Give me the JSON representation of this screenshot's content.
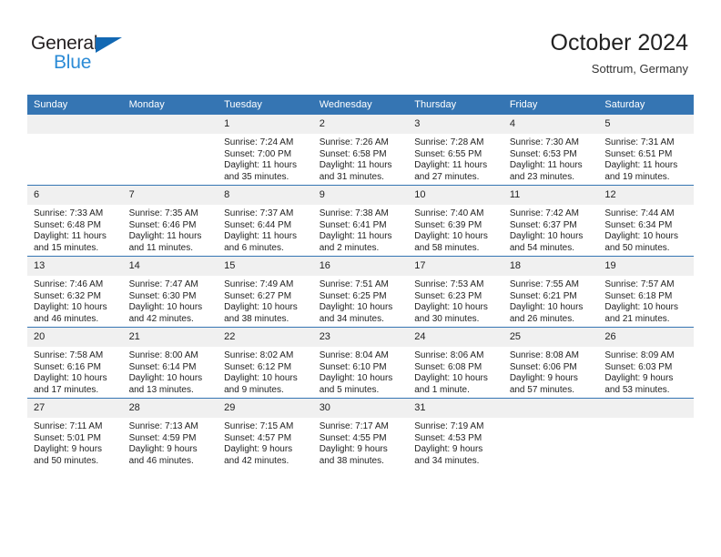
{
  "brand": {
    "name_part1": "General",
    "name_part2": "Blue",
    "accent_color": "#2b8bd6",
    "triangle_color": "#1268b3"
  },
  "header": {
    "title": "October 2024",
    "subtitle": "Sottrum, Germany"
  },
  "theme": {
    "header_bar_color": "#3575b3",
    "daynum_band_color": "#f0f0f0",
    "text_color": "#222222"
  },
  "weekdays": [
    "Sunday",
    "Monday",
    "Tuesday",
    "Wednesday",
    "Thursday",
    "Friday",
    "Saturday"
  ],
  "labels": {
    "sunrise": "Sunrise:",
    "sunset": "Sunset:",
    "daylight": "Daylight:"
  },
  "weeks": [
    [
      {
        "day": "",
        "sunrise": "",
        "sunset": "",
        "daylight_line1": "",
        "daylight_line2": ""
      },
      {
        "day": "",
        "sunrise": "",
        "sunset": "",
        "daylight_line1": "",
        "daylight_line2": ""
      },
      {
        "day": "1",
        "sunrise": "Sunrise: 7:24 AM",
        "sunset": "Sunset: 7:00 PM",
        "daylight_line1": "Daylight: 11 hours",
        "daylight_line2": "and 35 minutes."
      },
      {
        "day": "2",
        "sunrise": "Sunrise: 7:26 AM",
        "sunset": "Sunset: 6:58 PM",
        "daylight_line1": "Daylight: 11 hours",
        "daylight_line2": "and 31 minutes."
      },
      {
        "day": "3",
        "sunrise": "Sunrise: 7:28 AM",
        "sunset": "Sunset: 6:55 PM",
        "daylight_line1": "Daylight: 11 hours",
        "daylight_line2": "and 27 minutes."
      },
      {
        "day": "4",
        "sunrise": "Sunrise: 7:30 AM",
        "sunset": "Sunset: 6:53 PM",
        "daylight_line1": "Daylight: 11 hours",
        "daylight_line2": "and 23 minutes."
      },
      {
        "day": "5",
        "sunrise": "Sunrise: 7:31 AM",
        "sunset": "Sunset: 6:51 PM",
        "daylight_line1": "Daylight: 11 hours",
        "daylight_line2": "and 19 minutes."
      }
    ],
    [
      {
        "day": "6",
        "sunrise": "Sunrise: 7:33 AM",
        "sunset": "Sunset: 6:48 PM",
        "daylight_line1": "Daylight: 11 hours",
        "daylight_line2": "and 15 minutes."
      },
      {
        "day": "7",
        "sunrise": "Sunrise: 7:35 AM",
        "sunset": "Sunset: 6:46 PM",
        "daylight_line1": "Daylight: 11 hours",
        "daylight_line2": "and 11 minutes."
      },
      {
        "day": "8",
        "sunrise": "Sunrise: 7:37 AM",
        "sunset": "Sunset: 6:44 PM",
        "daylight_line1": "Daylight: 11 hours",
        "daylight_line2": "and 6 minutes."
      },
      {
        "day": "9",
        "sunrise": "Sunrise: 7:38 AM",
        "sunset": "Sunset: 6:41 PM",
        "daylight_line1": "Daylight: 11 hours",
        "daylight_line2": "and 2 minutes."
      },
      {
        "day": "10",
        "sunrise": "Sunrise: 7:40 AM",
        "sunset": "Sunset: 6:39 PM",
        "daylight_line1": "Daylight: 10 hours",
        "daylight_line2": "and 58 minutes."
      },
      {
        "day": "11",
        "sunrise": "Sunrise: 7:42 AM",
        "sunset": "Sunset: 6:37 PM",
        "daylight_line1": "Daylight: 10 hours",
        "daylight_line2": "and 54 minutes."
      },
      {
        "day": "12",
        "sunrise": "Sunrise: 7:44 AM",
        "sunset": "Sunset: 6:34 PM",
        "daylight_line1": "Daylight: 10 hours",
        "daylight_line2": "and 50 minutes."
      }
    ],
    [
      {
        "day": "13",
        "sunrise": "Sunrise: 7:46 AM",
        "sunset": "Sunset: 6:32 PM",
        "daylight_line1": "Daylight: 10 hours",
        "daylight_line2": "and 46 minutes."
      },
      {
        "day": "14",
        "sunrise": "Sunrise: 7:47 AM",
        "sunset": "Sunset: 6:30 PM",
        "daylight_line1": "Daylight: 10 hours",
        "daylight_line2": "and 42 minutes."
      },
      {
        "day": "15",
        "sunrise": "Sunrise: 7:49 AM",
        "sunset": "Sunset: 6:27 PM",
        "daylight_line1": "Daylight: 10 hours",
        "daylight_line2": "and 38 minutes."
      },
      {
        "day": "16",
        "sunrise": "Sunrise: 7:51 AM",
        "sunset": "Sunset: 6:25 PM",
        "daylight_line1": "Daylight: 10 hours",
        "daylight_line2": "and 34 minutes."
      },
      {
        "day": "17",
        "sunrise": "Sunrise: 7:53 AM",
        "sunset": "Sunset: 6:23 PM",
        "daylight_line1": "Daylight: 10 hours",
        "daylight_line2": "and 30 minutes."
      },
      {
        "day": "18",
        "sunrise": "Sunrise: 7:55 AM",
        "sunset": "Sunset: 6:21 PM",
        "daylight_line1": "Daylight: 10 hours",
        "daylight_line2": "and 26 minutes."
      },
      {
        "day": "19",
        "sunrise": "Sunrise: 7:57 AM",
        "sunset": "Sunset: 6:18 PM",
        "daylight_line1": "Daylight: 10 hours",
        "daylight_line2": "and 21 minutes."
      }
    ],
    [
      {
        "day": "20",
        "sunrise": "Sunrise: 7:58 AM",
        "sunset": "Sunset: 6:16 PM",
        "daylight_line1": "Daylight: 10 hours",
        "daylight_line2": "and 17 minutes."
      },
      {
        "day": "21",
        "sunrise": "Sunrise: 8:00 AM",
        "sunset": "Sunset: 6:14 PM",
        "daylight_line1": "Daylight: 10 hours",
        "daylight_line2": "and 13 minutes."
      },
      {
        "day": "22",
        "sunrise": "Sunrise: 8:02 AM",
        "sunset": "Sunset: 6:12 PM",
        "daylight_line1": "Daylight: 10 hours",
        "daylight_line2": "and 9 minutes."
      },
      {
        "day": "23",
        "sunrise": "Sunrise: 8:04 AM",
        "sunset": "Sunset: 6:10 PM",
        "daylight_line1": "Daylight: 10 hours",
        "daylight_line2": "and 5 minutes."
      },
      {
        "day": "24",
        "sunrise": "Sunrise: 8:06 AM",
        "sunset": "Sunset: 6:08 PM",
        "daylight_line1": "Daylight: 10 hours",
        "daylight_line2": "and 1 minute."
      },
      {
        "day": "25",
        "sunrise": "Sunrise: 8:08 AM",
        "sunset": "Sunset: 6:06 PM",
        "daylight_line1": "Daylight: 9 hours",
        "daylight_line2": "and 57 minutes."
      },
      {
        "day": "26",
        "sunrise": "Sunrise: 8:09 AM",
        "sunset": "Sunset: 6:03 PM",
        "daylight_line1": "Daylight: 9 hours",
        "daylight_line2": "and 53 minutes."
      }
    ],
    [
      {
        "day": "27",
        "sunrise": "Sunrise: 7:11 AM",
        "sunset": "Sunset: 5:01 PM",
        "daylight_line1": "Daylight: 9 hours",
        "daylight_line2": "and 50 minutes."
      },
      {
        "day": "28",
        "sunrise": "Sunrise: 7:13 AM",
        "sunset": "Sunset: 4:59 PM",
        "daylight_line1": "Daylight: 9 hours",
        "daylight_line2": "and 46 minutes."
      },
      {
        "day": "29",
        "sunrise": "Sunrise: 7:15 AM",
        "sunset": "Sunset: 4:57 PM",
        "daylight_line1": "Daylight: 9 hours",
        "daylight_line2": "and 42 minutes."
      },
      {
        "day": "30",
        "sunrise": "Sunrise: 7:17 AM",
        "sunset": "Sunset: 4:55 PM",
        "daylight_line1": "Daylight: 9 hours",
        "daylight_line2": "and 38 minutes."
      },
      {
        "day": "31",
        "sunrise": "Sunrise: 7:19 AM",
        "sunset": "Sunset: 4:53 PM",
        "daylight_line1": "Daylight: 9 hours",
        "daylight_line2": "and 34 minutes."
      },
      {
        "day": "",
        "sunrise": "",
        "sunset": "",
        "daylight_line1": "",
        "daylight_line2": ""
      },
      {
        "day": "",
        "sunrise": "",
        "sunset": "",
        "daylight_line1": "",
        "daylight_line2": ""
      }
    ]
  ]
}
